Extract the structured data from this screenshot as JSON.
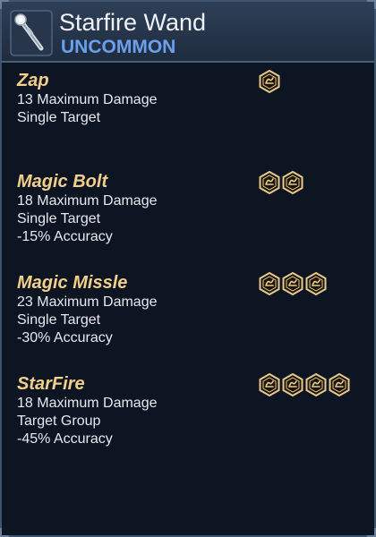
{
  "item": {
    "name": "Starfire Wand",
    "rarity": "UNCOMMON",
    "icon": "wand-icon"
  },
  "colors": {
    "ability_name": "#f2cf8a",
    "rarity": "#6aa0ef",
    "cost_icon": "#e8c98d"
  },
  "abilities": [
    {
      "name": "Zap",
      "cost": 1,
      "lines": [
        "13 Maximum Damage",
        "Single Target"
      ]
    },
    {
      "name": "Magic Bolt",
      "cost": 2,
      "lines": [
        "18 Maximum Damage",
        "Single Target",
        "-15% Accuracy"
      ]
    },
    {
      "name": "Magic Missle",
      "cost": 3,
      "lines": [
        "23 Maximum Damage",
        "Single Target",
        "-30% Accuracy"
      ]
    },
    {
      "name": "StarFire",
      "cost": 4,
      "lines": [
        "18 Maximum Damage",
        "Target Group",
        "-45% Accuracy"
      ]
    }
  ]
}
